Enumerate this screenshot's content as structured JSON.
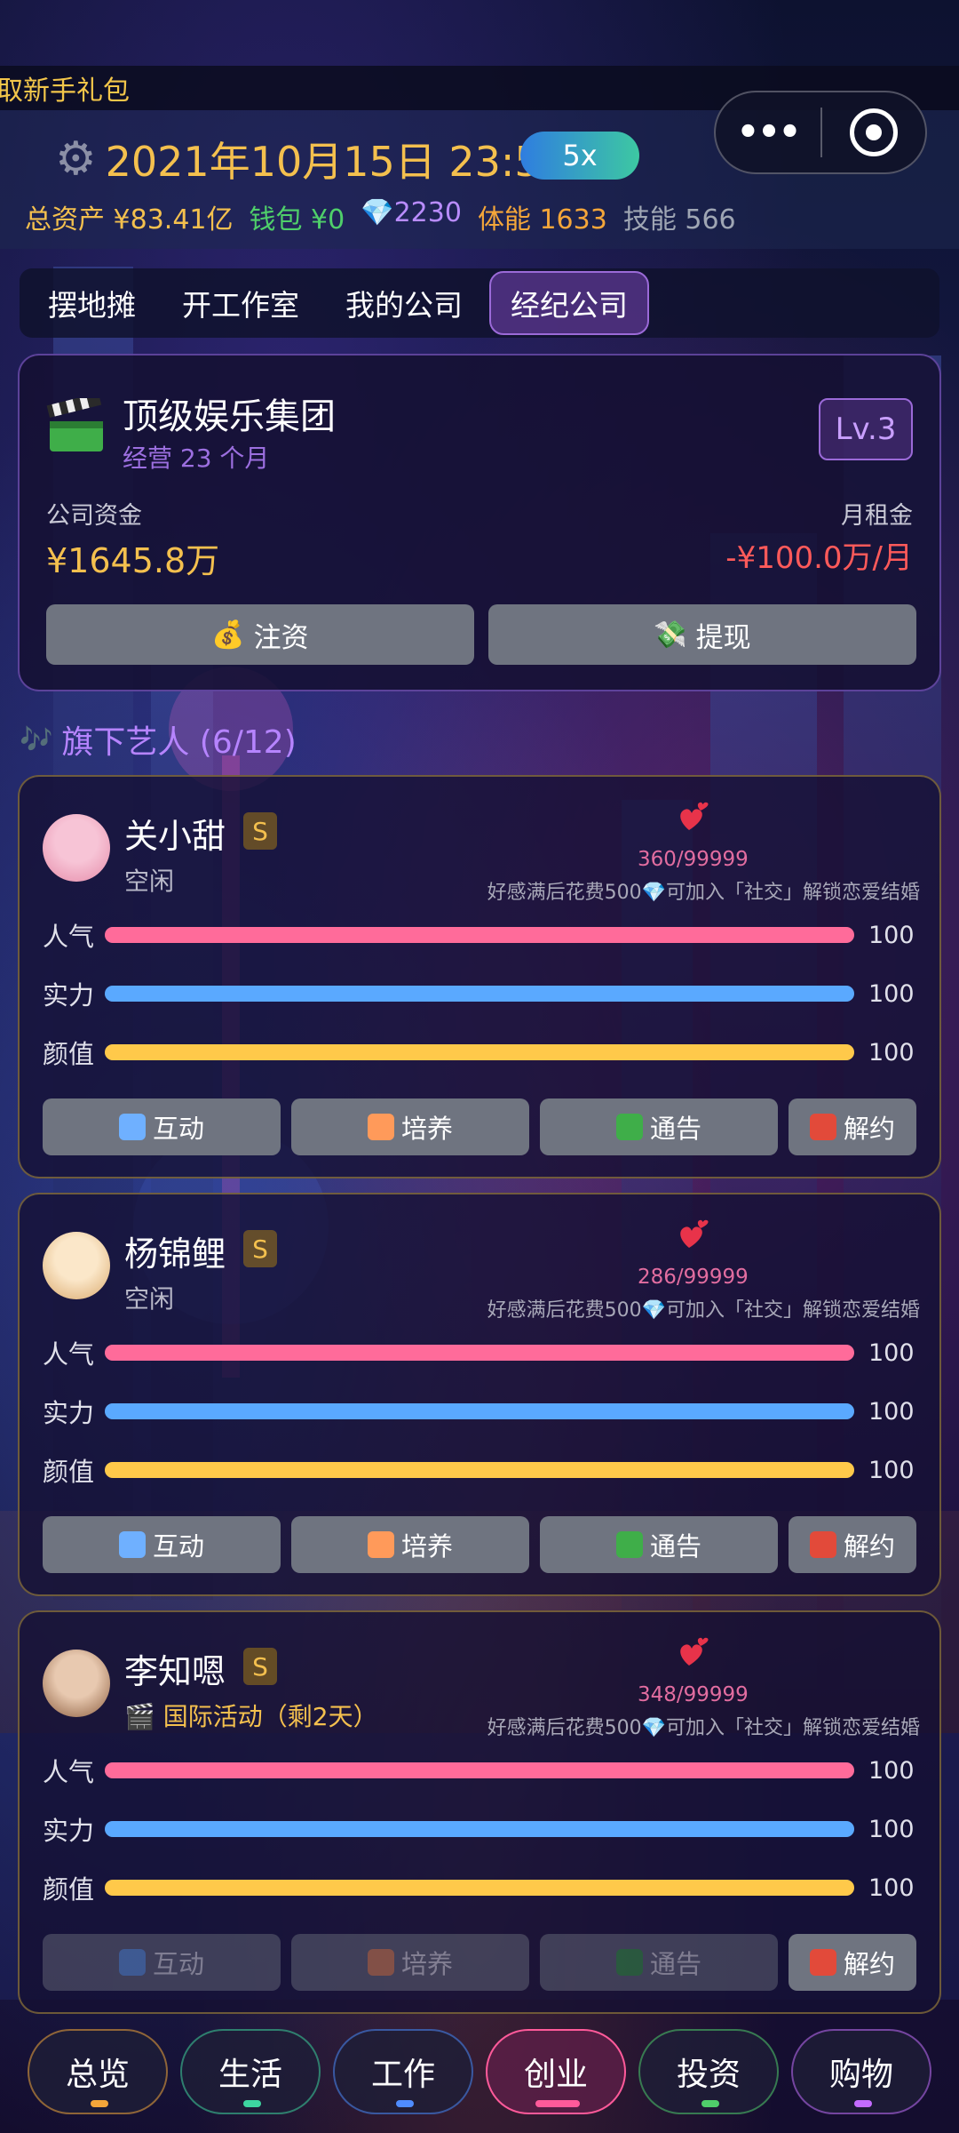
{
  "banner": {
    "gift_text": "取新手礼包"
  },
  "header": {
    "date_time": "2021年10月15日 23:53",
    "speed": "5x",
    "stats": [
      {
        "label": "总资产 ¥83.41亿",
        "color": "#f4c04e"
      },
      {
        "label": "钱包 ¥0",
        "color": "#4fcf6a"
      },
      {
        "label": "💎2230",
        "color": "#b98cff"
      },
      {
        "label": "体能 1633",
        "color": "#f4a63a"
      },
      {
        "label": "技能 566",
        "color": "#9fa6b4"
      }
    ]
  },
  "tabs": [
    "摆地摊",
    "开工作室",
    "我的公司",
    "经纪公司"
  ],
  "company": {
    "name": "顶级娱乐集团",
    "months": "经营 23 个月",
    "level": "Lv.3",
    "fund_label": "公司资金",
    "fund_value": "¥1645.8万",
    "rent_label": "月租金",
    "rent_value": "-¥100.0万/月",
    "buttons": [
      {
        "icon": "money-bag-icon",
        "label": "注资"
      },
      {
        "icon": "money-wings-icon",
        "label": "提现"
      }
    ]
  },
  "artists_title": "旗下艺人 (6/12)",
  "artists": [
    {
      "name": "关小甜",
      "grade": "S",
      "status": "空闲",
      "busy": false,
      "affection": "360/99999",
      "tip": "好感满后花费500💎可加入「社交」解锁恋爱结婚",
      "stats": [
        {
          "label": "人气",
          "value": 100,
          "color": "#ff6b9a"
        },
        {
          "label": "实力",
          "value": 100,
          "color": "#5aa9ff"
        },
        {
          "label": "颜值",
          "value": 100,
          "color": "#ffc94a"
        }
      ],
      "avatar_colors": [
        "#f7c4d6",
        "#e58aa8"
      ],
      "buttons_disabled": false
    },
    {
      "name": "杨锦鲤",
      "grade": "S",
      "status": "空闲",
      "busy": false,
      "affection": "286/99999",
      "tip": "好感满后花费500💎可加入「社交」解锁恋爱结婚",
      "stats": [
        {
          "label": "人气",
          "value": 100,
          "color": "#ff6b9a"
        },
        {
          "label": "实力",
          "value": 100,
          "color": "#5aa9ff"
        },
        {
          "label": "颜值",
          "value": 100,
          "color": "#ffc94a"
        }
      ],
      "avatar_colors": [
        "#fbe7c9",
        "#d9a86c"
      ],
      "buttons_disabled": false
    },
    {
      "name": "李知嗯",
      "grade": "S",
      "status": "🎬 国际活动（剩2天）",
      "busy": true,
      "affection": "348/99999",
      "tip": "好感满后花费500💎可加入「社交」解锁恋爱结婚",
      "stats": [
        {
          "label": "人气",
          "value": 100,
          "color": "#ff6b9a"
        },
        {
          "label": "实力",
          "value": 100,
          "color": "#5aa9ff"
        },
        {
          "label": "颜值",
          "value": 100,
          "color": "#ffc94a"
        }
      ],
      "avatar_colors": [
        "#e8c9b0",
        "#8a5b3c"
      ],
      "buttons_disabled": true
    }
  ],
  "artist_buttons": [
    {
      "icon": "speech-bubble-icon",
      "label": "互动"
    },
    {
      "icon": "books-icon",
      "label": "培养"
    },
    {
      "icon": "clapper-icon",
      "label": "通告"
    },
    {
      "icon": "door-icon",
      "label": "解约"
    }
  ],
  "nav": [
    {
      "label": "总览",
      "color": "#f4a63a"
    },
    {
      "label": "生活",
      "color": "#3dd6a0"
    },
    {
      "label": "工作",
      "color": "#4f8cff"
    },
    {
      "label": "创业",
      "color": "#ff5a9a",
      "active": true
    },
    {
      "label": "投资",
      "color": "#4fcf6a"
    },
    {
      "label": "购物",
      "color": "#c36bff"
    }
  ]
}
